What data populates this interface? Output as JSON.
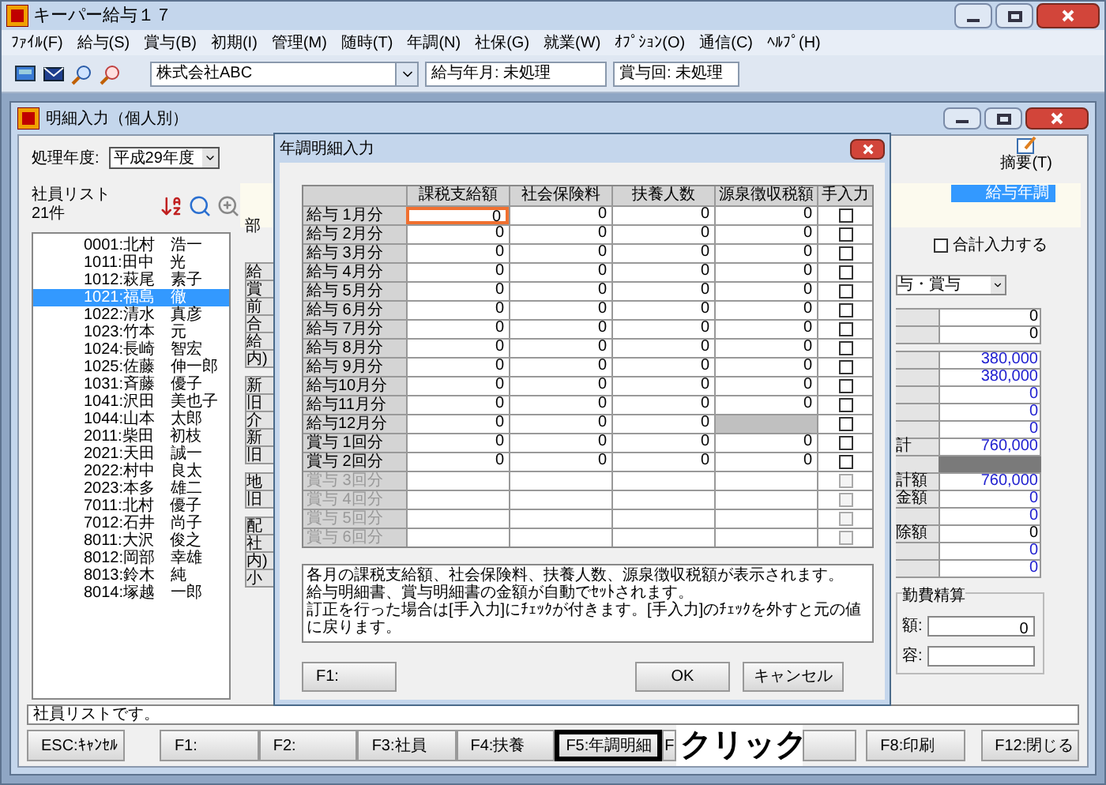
{
  "app": {
    "title": "キーパー給与１７"
  },
  "menu": [
    "ﾌｧｲﾙ(F)",
    "給与(S)",
    "賞与(B)",
    "初期(I)",
    "管理(M)",
    "随時(T)",
    "年調(N)",
    "社保(G)",
    "就業(W)",
    "ｵﾌﾟｼｮﾝ(O)",
    "通信(C)",
    "ﾍﾙﾌﾟ(H)"
  ],
  "toolbar": {
    "company": "株式会社ABC",
    "pay_month": "給与年月: 未処理",
    "bonus_round": "賞与回: 未処理"
  },
  "window": {
    "title": "明細入力（個人別）",
    "year_label": "処理年度:",
    "year": "平成29年度",
    "summary_button": "摘要(T)",
    "mode_badge": "給与年調",
    "dept_label": "部",
    "total_input": {
      "label": "合計入力する",
      "checked": false
    },
    "pay_type": "与・賞与",
    "employee_list": {
      "title": "社員リスト",
      "count": "21件",
      "items": [
        {
          "label": "0001:北村　浩一",
          "selected": false
        },
        {
          "label": "1011:田中　光",
          "selected": false
        },
        {
          "label": "1012:萩尾　素子",
          "selected": false
        },
        {
          "label": "1021:福島　徹",
          "selected": true
        },
        {
          "label": "1022:清水　真彦",
          "selected": false
        },
        {
          "label": "1023:竹本　元",
          "selected": false
        },
        {
          "label": "1024:長崎　智宏",
          "selected": false
        },
        {
          "label": "1025:佐藤　伸一郎",
          "selected": false
        },
        {
          "label": "1031:斉藤　優子",
          "selected": false
        },
        {
          "label": "1041:沢田　美也子",
          "selected": false
        },
        {
          "label": "1044:山本　太郎",
          "selected": false
        },
        {
          "label": "2011:柴田　初枝",
          "selected": false
        },
        {
          "label": "2021:天田　誠一",
          "selected": false
        },
        {
          "label": "2022:村中　良太",
          "selected": false
        },
        {
          "label": "2023:本多　雄二",
          "selected": false
        },
        {
          "label": "7011:北村　優子",
          "selected": false
        },
        {
          "label": "7012:石井　尚子",
          "selected": false
        },
        {
          "label": "8011:大沢　俊之",
          "selected": false
        },
        {
          "label": "8012:岡部　幸雄",
          "selected": false
        },
        {
          "label": "8013:鈴木　純",
          "selected": false
        },
        {
          "label": "8014:塚越　一郎",
          "selected": false
        }
      ]
    },
    "label_fragments": [
      [
        "給",
        "賞",
        "前",
        "合",
        "給",
        "内)"
      ],
      [
        "新",
        "旧",
        "介",
        "新",
        "旧"
      ],
      [
        "地",
        "旧"
      ],
      [
        "配",
        "社",
        "内)",
        "小"
      ]
    ],
    "value_groups": [
      [
        {
          "value": "0",
          "color": "#000000"
        },
        {
          "value": "0",
          "color": "#000000"
        }
      ],
      [
        {
          "value": "380,000",
          "color": "#2020d0"
        },
        {
          "value": "380,000",
          "color": "#2020d0"
        },
        {
          "value": "0",
          "color": "#2020d0"
        },
        {
          "value": "0",
          "color": "#2020d0"
        },
        {
          "value": "0",
          "color": "#2020d0"
        },
        {
          "label": "計",
          "value": "760,000",
          "color": "#2020d0"
        },
        {
          "shaded": true
        },
        {
          "label": "計額",
          "value": "760,000",
          "color": "#2020d0"
        },
        {
          "label": "金額",
          "value": "0",
          "color": "#2020d0"
        },
        {
          "value": "0",
          "color": "#2020d0"
        },
        {
          "label": "除額",
          "value": "0",
          "color": "#000000"
        },
        {
          "value": "0",
          "color": "#2020d0"
        },
        {
          "value": "0",
          "color": "#2020d0"
        }
      ]
    ],
    "commute": {
      "title": "勤費精算",
      "amount_label": "額:",
      "amount": "0",
      "content_label": "容:"
    },
    "status": "社員リストです。",
    "function_keys": [
      {
        "label": "ESC:ｷｬﾝｾﾙ",
        "highlighted": false
      },
      {
        "label": "F1:",
        "highlighted": false
      },
      {
        "label": "F2:",
        "highlighted": false
      },
      {
        "label": "F3:社員",
        "highlighted": false
      },
      {
        "label": "F4:扶養",
        "highlighted": false
      },
      {
        "label": "F5:年調明細",
        "highlighted": true
      },
      {
        "label": "F",
        "highlighted": false
      },
      {
        "highlighted": false
      },
      {
        "label": "F8:印刷",
        "highlighted": false
      },
      {
        "label": "F12:閉じる",
        "highlighted": false
      }
    ],
    "annotation": "クリック"
  },
  "dialog": {
    "title": "年調明細入力",
    "columns": [
      "課税支給額",
      "社会保険料",
      "扶養人数",
      "源泉徴収税額",
      "手入力"
    ],
    "rows": [
      {
        "label": "給与 1月分",
        "cells": [
          "0",
          "0",
          "0",
          "0"
        ],
        "withholding_locked": false,
        "disabled": false,
        "focused": true,
        "checked": false
      },
      {
        "label": "給与 2月分",
        "cells": [
          "0",
          "0",
          "0",
          "0"
        ],
        "withholding_locked": false,
        "disabled": false,
        "focused": false,
        "checked": false
      },
      {
        "label": "給与 3月分",
        "cells": [
          "0",
          "0",
          "0",
          "0"
        ],
        "withholding_locked": false,
        "disabled": false,
        "focused": false,
        "checked": false
      },
      {
        "label": "給与 4月分",
        "cells": [
          "0",
          "0",
          "0",
          "0"
        ],
        "withholding_locked": false,
        "disabled": false,
        "focused": false,
        "checked": false
      },
      {
        "label": "給与 5月分",
        "cells": [
          "0",
          "0",
          "0",
          "0"
        ],
        "withholding_locked": false,
        "disabled": false,
        "focused": false,
        "checked": false
      },
      {
        "label": "給与 6月分",
        "cells": [
          "0",
          "0",
          "0",
          "0"
        ],
        "withholding_locked": false,
        "disabled": false,
        "focused": false,
        "checked": false
      },
      {
        "label": "給与 7月分",
        "cells": [
          "0",
          "0",
          "0",
          "0"
        ],
        "withholding_locked": false,
        "disabled": false,
        "focused": false,
        "checked": false
      },
      {
        "label": "給与 8月分",
        "cells": [
          "0",
          "0",
          "0",
          "0"
        ],
        "withholding_locked": false,
        "disabled": false,
        "focused": false,
        "checked": false
      },
      {
        "label": "給与 9月分",
        "cells": [
          "0",
          "0",
          "0",
          "0"
        ],
        "withholding_locked": false,
        "disabled": false,
        "focused": false,
        "checked": false
      },
      {
        "label": "給与10月分",
        "cells": [
          "0",
          "0",
          "0",
          "0"
        ],
        "withholding_locked": false,
        "disabled": false,
        "focused": false,
        "checked": false
      },
      {
        "label": "給与11月分",
        "cells": [
          "0",
          "0",
          "0",
          "0"
        ],
        "withholding_locked": false,
        "disabled": false,
        "focused": false,
        "checked": false
      },
      {
        "label": "給与12月分",
        "cells": [
          "0",
          "0",
          "0"
        ],
        "withholding_locked": true,
        "disabled": false,
        "focused": false,
        "checked": false
      },
      {
        "label": "賞与 1回分",
        "cells": [
          "0",
          "0",
          "0",
          "0"
        ],
        "withholding_locked": false,
        "disabled": false,
        "focused": false,
        "checked": false
      },
      {
        "label": "賞与 2回分",
        "cells": [
          "0",
          "0",
          "0",
          "0"
        ],
        "withholding_locked": false,
        "disabled": false,
        "focused": false,
        "checked": false
      },
      {
        "label": "賞与 3回分",
        "cells": [],
        "withholding_locked": false,
        "disabled": true,
        "focused": false,
        "checked": false
      },
      {
        "label": "賞与 4回分",
        "cells": [],
        "withholding_locked": false,
        "disabled": true,
        "focused": false,
        "checked": false
      },
      {
        "label": "賞与 5回分",
        "cells": [],
        "withholding_locked": false,
        "disabled": true,
        "focused": false,
        "checked": false
      },
      {
        "label": "賞与 6回分",
        "cells": [],
        "withholding_locked": false,
        "disabled": true,
        "focused": false,
        "checked": false
      }
    ],
    "note": [
      "各月の課税支給額、社会保険料、扶養人数、源泉徴収税額が表示されます。",
      "給与明細書、賞与明細書の金額が自動でｾｯﾄされます。",
      "訂正を行った場合は[手入力]にﾁｪｯｸが付きます。[手入力]のﾁｪｯｸを外すと元の値に戻ります。"
    ],
    "buttons": {
      "help": "F1:",
      "ok": "OK",
      "cancel": "キャンセル"
    }
  }
}
